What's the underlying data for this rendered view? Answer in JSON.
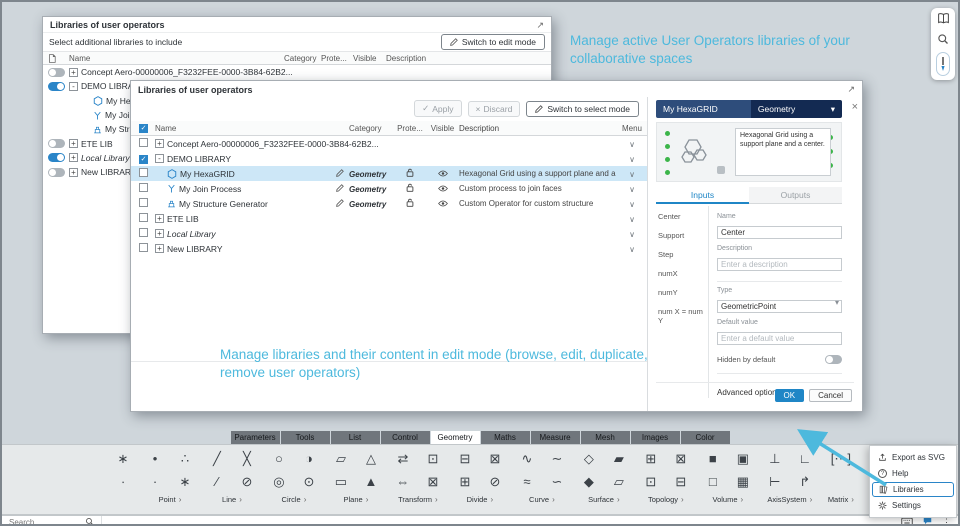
{
  "colors": {
    "accent": "#1f86c6",
    "annotation": "#4db9dd",
    "selection": "#cde7f7",
    "header_navy": "#132a52",
    "header_navy_light": "#2e4d7b",
    "port_green": "#3cb54a"
  },
  "icons": {
    "expand": "↗",
    "dropdown": "▾",
    "menu_chevron": "∨",
    "check": "✓",
    "close": "×"
  },
  "annotations": {
    "top": "Manage active User Operators libraries of your collaborative spaces",
    "bottom": "Manage libraries and their content in edit mode (browse, edit, duplicate, remove user operators)"
  },
  "select_dialog": {
    "title": "Libraries of user operators",
    "subtitle": "Select additional libraries to include",
    "switch_button": "Switch to edit mode",
    "columns": {
      "name": "Name",
      "category": "Category",
      "protected": "Prote...",
      "visible": "Visible",
      "description": "Description"
    },
    "rows": [
      {
        "name": "Concept Aero-00000006_F3232FEE-0000-3B84-62B2...",
        "toggle": "off",
        "expander": "+"
      },
      {
        "name": "DEMO LIBRARY",
        "toggle": "on",
        "expander": "-"
      },
      {
        "name": "My HexaGRID",
        "child": true
      },
      {
        "name": "My Join Process",
        "child": true
      },
      {
        "name": "My Structure Generator",
        "child": true
      },
      {
        "name": "ETE LIB",
        "toggle": "off",
        "expander": "+"
      },
      {
        "name": "Local Library",
        "toggle": "on",
        "expander": "+"
      },
      {
        "name": "New LIBRARY",
        "toggle": "off",
        "expander": "+"
      }
    ]
  },
  "edit_dialog": {
    "title": "Libraries of user operators",
    "toolbar": {
      "apply": "Apply",
      "discard": "Discard",
      "switch_button": "Switch to select mode"
    },
    "columns": {
      "name": "Name",
      "category": "Category",
      "protected": "Prote...",
      "visible": "Visible",
      "description": "Description",
      "menu": "Menu"
    },
    "rows": [
      {
        "name": "Concept Aero-00000006_F3232FEE-0000-3B84-62B2...",
        "expander": "+",
        "checked": false
      },
      {
        "name": "DEMO LIBRARY",
        "expander": "-",
        "checked": true
      },
      {
        "name": "My HexaGRID",
        "category": "Geometry",
        "description": "Hexagonal Grid using a support plane and a center.",
        "selected": true
      },
      {
        "name": "My Join Process",
        "category": "Geometry",
        "description": "Custom process to join faces"
      },
      {
        "name": "My Structure Generator",
        "category": "Geometry",
        "description": "Custom Operator for custom structure"
      },
      {
        "name": "ETE LIB",
        "expander": "+"
      },
      {
        "name": "Local Library",
        "expander": "+"
      },
      {
        "name": "New LIBRARY",
        "expander": "+"
      }
    ]
  },
  "operator_panel": {
    "name": "My HexaGRID",
    "category": "Geometry",
    "preview_description": "Hexagonal Grid using a support plane and a center.",
    "tabs": {
      "inputs": "Inputs",
      "outputs": "Outputs"
    },
    "parameters": [
      "Center",
      "Support",
      "Step",
      "numX",
      "numY",
      "num X = num Y"
    ],
    "form": {
      "name_label": "Name",
      "name_value": "Center",
      "description_label": "Description",
      "description_placeholder": "Enter a description",
      "type_label": "Type",
      "type_value": "GeometricPoint",
      "default_label": "Default value",
      "default_placeholder": "Enter a default value",
      "hidden_label": "Hidden by default",
      "advanced_label": "Advanced options",
      "advanced_plus": "+"
    },
    "ok": "OK",
    "cancel": "Cancel"
  },
  "action_bar": {
    "tabs": [
      "Parameters",
      "Tools",
      "List",
      "Control",
      "Geometry",
      "Maths",
      "Measure",
      "Mesh",
      "Images",
      "Color"
    ],
    "active_tab": "Geometry",
    "lead": [
      "∗",
      "∙"
    ],
    "groups": [
      {
        "label": "Point",
        "r1": [
          "•",
          "∴"
        ],
        "r2": [
          "·",
          "∗"
        ]
      },
      {
        "label": "Line",
        "r1": [
          "╱",
          "╳"
        ],
        "r2": [
          "∕",
          "⊘"
        ]
      },
      {
        "label": "Circle",
        "r1": [
          "○",
          "◑"
        ],
        "r2": [
          "◎",
          "⊙"
        ]
      },
      {
        "label": "Plane",
        "r1": [
          "▱",
          "△"
        ],
        "r2": [
          "▭",
          "▲"
        ]
      },
      {
        "label": "Transform",
        "r1": [
          "⇄",
          "⊡"
        ],
        "r2": [
          "⇔",
          "⊠"
        ]
      },
      {
        "label": "Divide",
        "r1": [
          "⊟",
          "⊠"
        ],
        "r2": [
          "⊞",
          "⊘"
        ]
      },
      {
        "label": "Curve",
        "r1": [
          "∿",
          "∼"
        ],
        "r2": [
          "≈",
          "∽"
        ]
      },
      {
        "label": "Surface",
        "r1": [
          "◇",
          "▰"
        ],
        "r2": [
          "◆",
          "▱"
        ]
      },
      {
        "label": "Topology",
        "r1": [
          "⊞",
          "⊠"
        ],
        "r2": [
          "⊡",
          "⊟"
        ]
      },
      {
        "label": "Volume",
        "r1": [
          "■",
          "▣"
        ],
        "r2": [
          "□",
          "▦"
        ]
      },
      {
        "label": "AxisSystem",
        "r1": [
          "⊥",
          "∟"
        ],
        "r2": [
          "⊢",
          "↱"
        ]
      },
      {
        "label": "Matrix",
        "r1": [
          "[⋯]"
        ],
        "r2": []
      }
    ]
  },
  "context_menu": {
    "items": [
      {
        "label": "Export as SVG"
      },
      {
        "label": "Help"
      },
      {
        "label": "Libraries",
        "highlighted": true
      },
      {
        "label": "Settings"
      }
    ]
  },
  "status_bar": {
    "search_placeholder": "Search"
  }
}
